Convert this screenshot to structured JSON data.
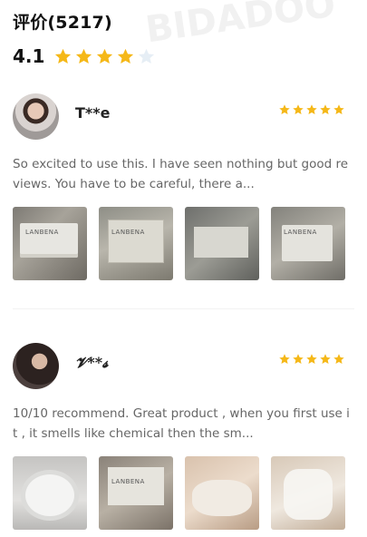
{
  "header": {
    "title": "评价(5217)"
  },
  "summary": {
    "rating": "4.1",
    "stars_filled": 4,
    "stars_total": 5,
    "star_color": "#F5B818",
    "star_empty_color": "#E6EEF5"
  },
  "reviews": [
    {
      "name": "T**e",
      "stars": 5,
      "text": "So excited to use this. I have seen nothing but good reviews. You have to be careful, there a...",
      "photo_labels": [
        "LANBENA",
        "LANBENA",
        "",
        "LANBENA"
      ]
    },
    {
      "name": "𝓥**𝓼",
      "stars": 5,
      "text": "10/10 recommend. Great product , when you first use it , it smells like chemical then the sm...",
      "photo_labels": [
        "",
        "LANBENA",
        "",
        ""
      ]
    }
  ],
  "watermark": "BIDADOO"
}
